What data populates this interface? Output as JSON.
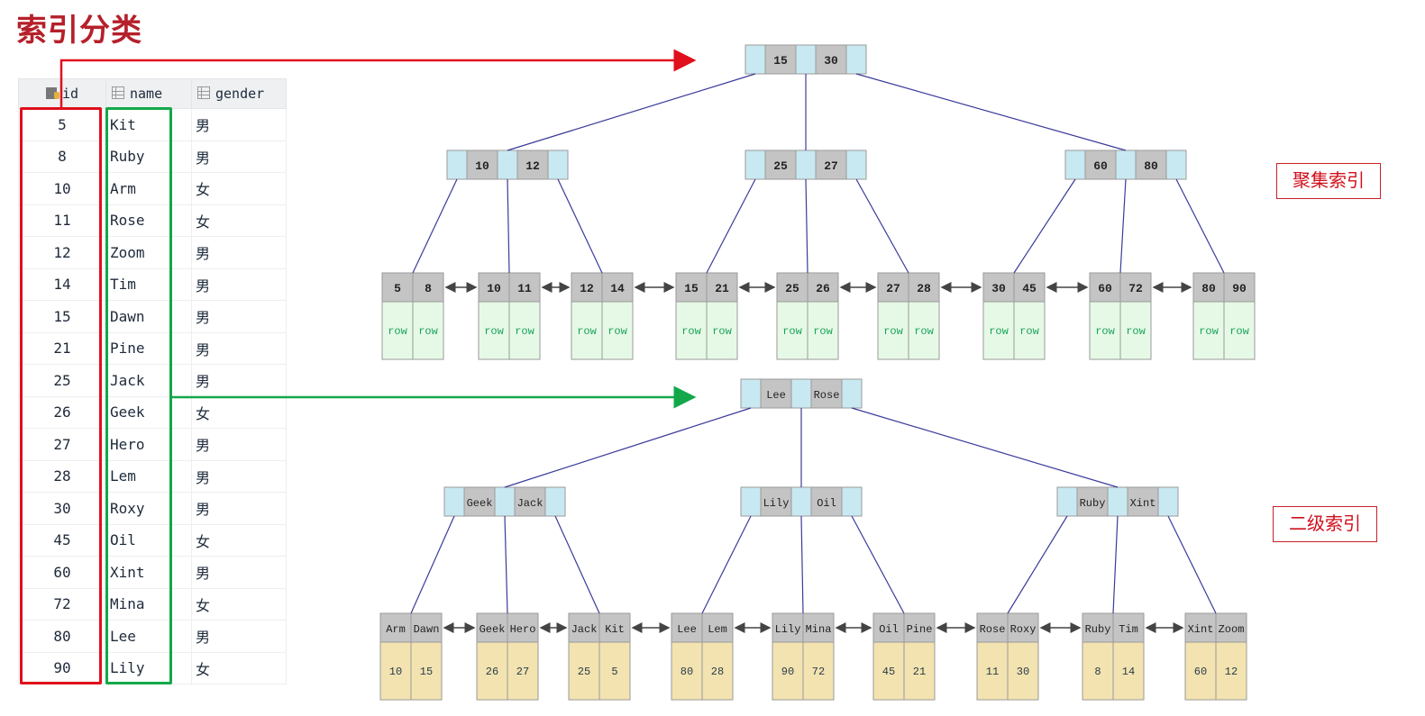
{
  "title": "索引分类",
  "table": {
    "columns": [
      {
        "label": "id",
        "icon": "primary-key-icon"
      },
      {
        "label": "name",
        "icon": "column-icon"
      },
      {
        "label": "gender",
        "icon": "column-icon"
      }
    ],
    "rows": [
      {
        "id": "5",
        "name": "Kit",
        "gender": "男"
      },
      {
        "id": "8",
        "name": "Ruby",
        "gender": "男"
      },
      {
        "id": "10",
        "name": "Arm",
        "gender": "女"
      },
      {
        "id": "11",
        "name": "Rose",
        "gender": "女"
      },
      {
        "id": "12",
        "name": "Zoom",
        "gender": "男"
      },
      {
        "id": "14",
        "name": "Tim",
        "gender": "男"
      },
      {
        "id": "15",
        "name": "Dawn",
        "gender": "男"
      },
      {
        "id": "21",
        "name": "Pine",
        "gender": "男"
      },
      {
        "id": "25",
        "name": "Jack",
        "gender": "男"
      },
      {
        "id": "26",
        "name": "Geek",
        "gender": "女"
      },
      {
        "id": "27",
        "name": "Hero",
        "gender": "男"
      },
      {
        "id": "28",
        "name": "Lem",
        "gender": "男"
      },
      {
        "id": "30",
        "name": "Roxy",
        "gender": "男"
      },
      {
        "id": "45",
        "name": "Oil",
        "gender": "女"
      },
      {
        "id": "60",
        "name": "Xint",
        "gender": "男"
      },
      {
        "id": "72",
        "name": "Mina",
        "gender": "女"
      },
      {
        "id": "80",
        "name": "Lee",
        "gender": "男"
      },
      {
        "id": "90",
        "name": "Lily",
        "gender": "女"
      }
    ]
  },
  "clustered": {
    "label": "聚集索引",
    "root": [
      "15",
      "30"
    ],
    "internal": [
      [
        "10",
        "12"
      ],
      [
        "25",
        "27"
      ],
      [
        "60",
        "80"
      ]
    ],
    "leaves": [
      {
        "keys": [
          "5",
          "8"
        ],
        "values": [
          "row",
          "row"
        ]
      },
      {
        "keys": [
          "10",
          "11"
        ],
        "values": [
          "row",
          "row"
        ]
      },
      {
        "keys": [
          "12",
          "14"
        ],
        "values": [
          "row",
          "row"
        ]
      },
      {
        "keys": [
          "15",
          "21"
        ],
        "values": [
          "row",
          "row"
        ]
      },
      {
        "keys": [
          "25",
          "26"
        ],
        "values": [
          "row",
          "row"
        ]
      },
      {
        "keys": [
          "27",
          "28"
        ],
        "values": [
          "row",
          "row"
        ]
      },
      {
        "keys": [
          "30",
          "45"
        ],
        "values": [
          "row",
          "row"
        ]
      },
      {
        "keys": [
          "60",
          "72"
        ],
        "values": [
          "row",
          "row"
        ]
      },
      {
        "keys": [
          "80",
          "90"
        ],
        "values": [
          "row",
          "row"
        ]
      }
    ]
  },
  "secondary": {
    "label": "二级索引",
    "root": [
      "Lee",
      "Rose"
    ],
    "internal": [
      [
        "Geek",
        "Jack"
      ],
      [
        "Lily",
        "Oil"
      ],
      [
        "Ruby",
        "Xint"
      ]
    ],
    "leaves": [
      {
        "keys": [
          "Arm",
          "Dawn"
        ],
        "values": [
          "10",
          "15"
        ]
      },
      {
        "keys": [
          "Geek",
          "Hero"
        ],
        "values": [
          "26",
          "27"
        ]
      },
      {
        "keys": [
          "Jack",
          "Kit"
        ],
        "values": [
          "25",
          "5"
        ]
      },
      {
        "keys": [
          "Lee",
          "Lem"
        ],
        "values": [
          "80",
          "28"
        ]
      },
      {
        "keys": [
          "Lily",
          "Mina"
        ],
        "values": [
          "90",
          "72"
        ]
      },
      {
        "keys": [
          "Oil",
          "Pine"
        ],
        "values": [
          "45",
          "21"
        ]
      },
      {
        "keys": [
          "Rose",
          "Roxy"
        ],
        "values": [
          "11",
          "30"
        ]
      },
      {
        "keys": [
          "Ruby",
          "Tim"
        ],
        "values": [
          "8",
          "14"
        ]
      },
      {
        "keys": [
          "Xint",
          "Zoom"
        ],
        "values": [
          "60",
          "12"
        ]
      }
    ]
  },
  "colors": {
    "title": "#b5202a",
    "highlight_id": "#e0101c",
    "highlight_name": "#12a84a",
    "node_key": "#c4c4c4",
    "node_pointer": "#c9e9f2",
    "leaf_row": "#e6f9e6",
    "leaf_index": "#f2e3b0",
    "edge": "#3b3b9a"
  }
}
